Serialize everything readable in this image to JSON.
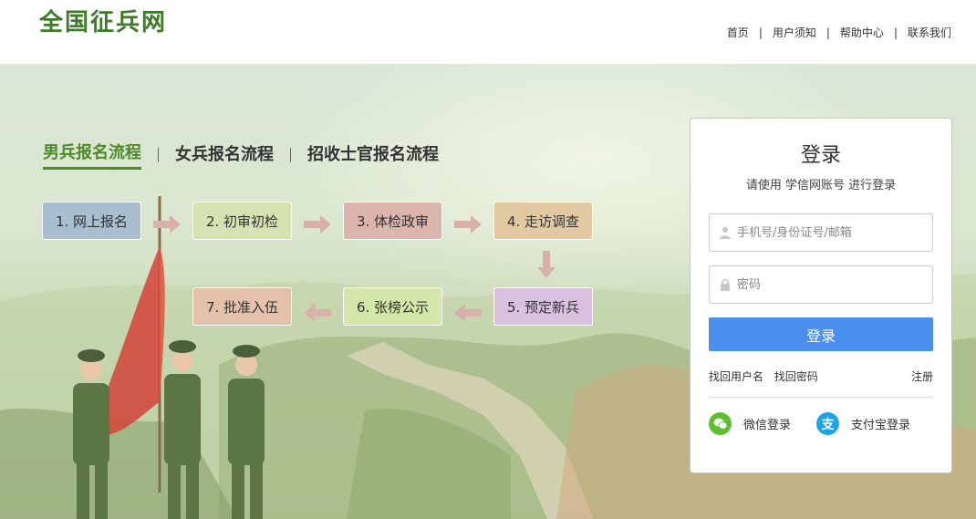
{
  "header": {
    "logo": "全国征兵网",
    "nav": [
      "首页",
      "用户须知",
      "帮助中心",
      "联系我们"
    ]
  },
  "tabs": [
    {
      "label": "男兵报名流程",
      "active": true
    },
    {
      "label": "女兵报名流程",
      "active": false
    },
    {
      "label": "招收士官报名流程",
      "active": false
    }
  ],
  "steps": [
    {
      "label": "1. 网上报名",
      "color": "#a9bfd0"
    },
    {
      "label": "2. 初审初检",
      "color": "#d6e2b2"
    },
    {
      "label": "3. 体检政审",
      "color": "#dcb6ad"
    },
    {
      "label": "4. 走访调查",
      "color": "#e2c9a2"
    },
    {
      "label": "5. 预定新兵",
      "color": "#d9c2e0"
    },
    {
      "label": "6. 张榜公示",
      "color": "#d4e7a8"
    },
    {
      "label": "7. 批准入伍",
      "color": "#e3c1aa"
    }
  ],
  "login": {
    "title": "登录",
    "subtitle": "请使用  学信网账号  进行登录",
    "username_placeholder": "手机号/身份证号/邮箱",
    "password_placeholder": "密码",
    "submit_label": "登录",
    "find_username": "找回用户名",
    "find_password": "找回密码",
    "register": "注册",
    "wechat_label": "微信登录",
    "alipay_label": "支付宝登录"
  },
  "colors": {
    "brand_green": "#3f7a29",
    "tab_active": "#4e8a2a",
    "login_button": "#4a8ef0",
    "wechat": "#5dbf2f",
    "alipay": "#1aa4e8",
    "arrow": "#d9b0aa"
  }
}
